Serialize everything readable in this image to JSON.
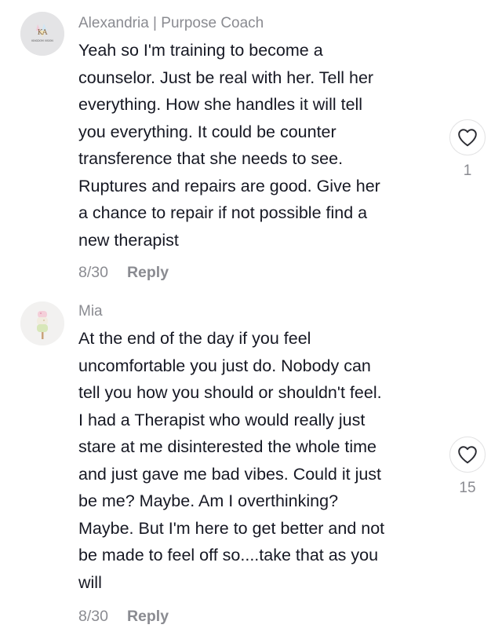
{
  "comments": [
    {
      "username": "Alexandria | Purpose Coach",
      "avatar_icon": "kingdom-vision-logo",
      "avatar_text": "KINGDOM VISION",
      "text_lines": [
        "Yeah so I'm training to become a",
        "counselor. Just be real with her. Tell her",
        "everything. How she handles it will tell",
        "you everything. It could be counter",
        "transference that she needs to see.",
        "Ruptures and repairs are good. Give her",
        "a chance to repair if not possible find a",
        "new therapist"
      ],
      "date": "8/30",
      "reply_label": "Reply",
      "like_icon": "heart-outline-icon",
      "likes": "1"
    },
    {
      "username": "Mia",
      "avatar_icon": "ice-cream-icon",
      "text_lines": [
        "At the end of the day if you feel",
        "uncomfortable you just do. Nobody can",
        "tell you how you should or shouldn't feel.",
        "I had a Therapist who would really just",
        "stare at me disinterested the whole time",
        "and just gave me bad vibes. Could it just",
        "be me? Maybe. Am I overthinking?",
        "Maybe. But I'm here to get better and not",
        "be made to feel off so....take that as you",
        "will"
      ],
      "date": "8/30",
      "reply_label": "Reply",
      "like_icon": "heart-outline-icon",
      "likes": "15"
    }
  ],
  "colors": {
    "text": "#161823",
    "secondary": "#8a8b91",
    "divider": "#e3e3e4"
  }
}
